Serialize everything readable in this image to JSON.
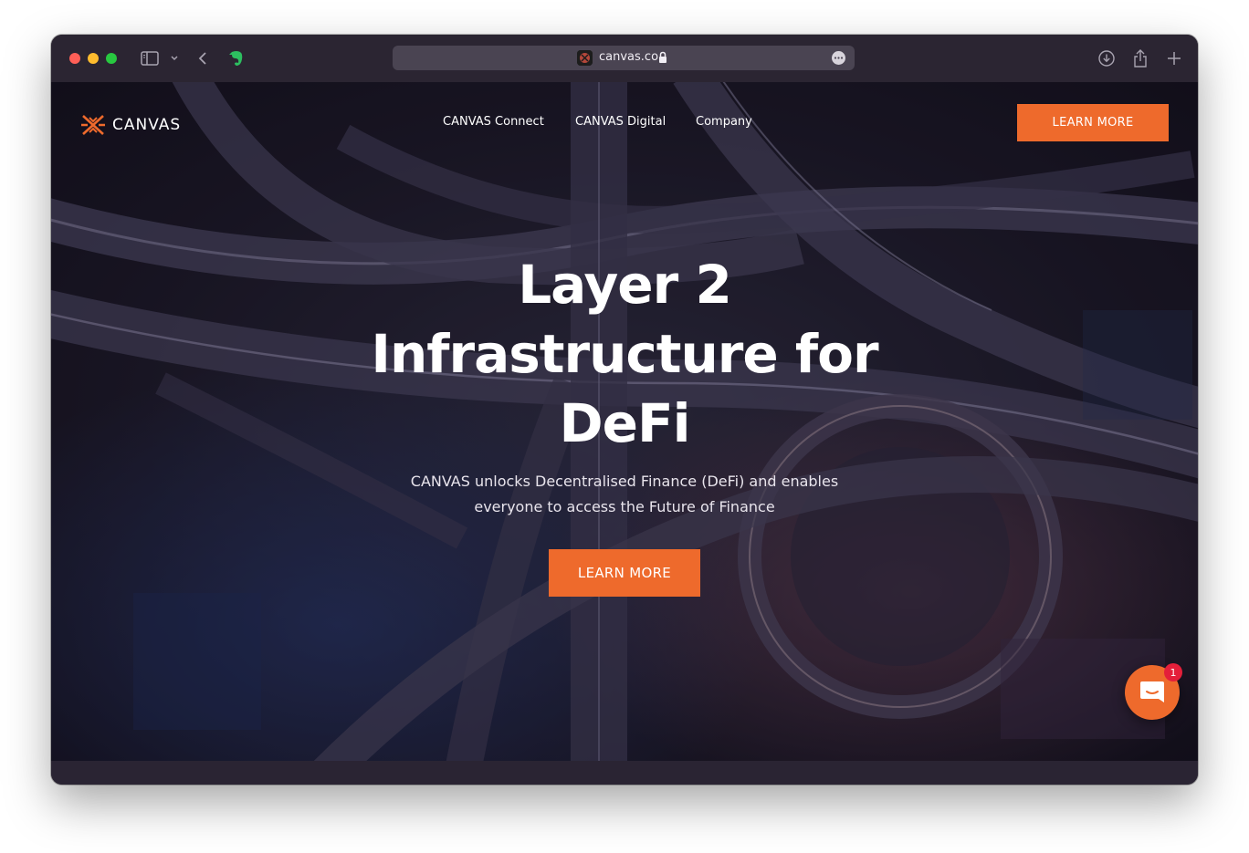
{
  "browser": {
    "url": "canvas.co",
    "colors": {
      "chrome": "#2b2532",
      "url_bar": "#4a4452"
    },
    "icons": [
      "sidebar-icon",
      "chevron-down-icon",
      "back-icon",
      "evernote-icon",
      "lock-icon",
      "more-icon",
      "download-icon",
      "share-icon",
      "plus-icon"
    ]
  },
  "header": {
    "logo_text": "CANVAS",
    "nav": [
      {
        "label": "CANVAS Connect"
      },
      {
        "label": "CANVAS Digital"
      },
      {
        "label": "Company"
      }
    ],
    "cta_label": "LEARN MORE"
  },
  "hero": {
    "title_lines": [
      "Layer 2",
      "Infrastructure for",
      "DeFi"
    ],
    "subtitle_lines": [
      "CANVAS unlocks Decentralised Finance (DeFi) and enables",
      "everyone to access the Future of Finance"
    ],
    "cta_label": "LEARN MORE"
  },
  "chat": {
    "badge_count": "1"
  },
  "colors": {
    "accent": "#ee6a2c",
    "badge": "#e41f3a",
    "text": "#ffffff"
  }
}
